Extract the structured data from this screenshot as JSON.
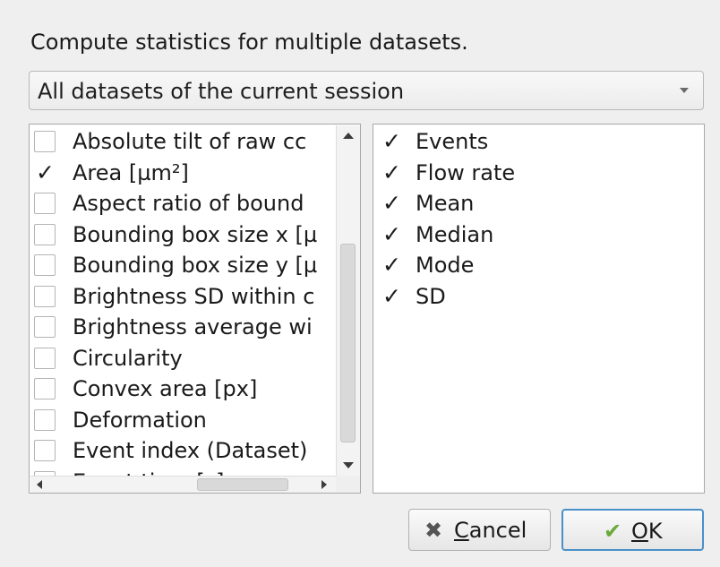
{
  "dialog": {
    "heading": "Compute statistics for multiple datasets.",
    "dataset_select": {
      "selected": "All datasets of the current session",
      "arrow_icon": "chevron-down-icon"
    }
  },
  "features": [
    {
      "label": "Absolute tilt of raw cc",
      "checked": false
    },
    {
      "label": "Area [µm²]",
      "checked": true
    },
    {
      "label": "Aspect ratio of bound",
      "checked": false
    },
    {
      "label": "Bounding box size x [µ",
      "checked": false
    },
    {
      "label": "Bounding box size y [µ",
      "checked": false
    },
    {
      "label": "Brightness SD within c",
      "checked": false
    },
    {
      "label": "Brightness average wi",
      "checked": false
    },
    {
      "label": "Circularity",
      "checked": false
    },
    {
      "label": "Convex area [px]",
      "checked": false
    },
    {
      "label": "Deformation",
      "checked": false
    },
    {
      "label": "Event index (Dataset)",
      "checked": false
    },
    {
      "label": "Event time [s]",
      "checked": false
    }
  ],
  "statistics": [
    {
      "label": "Events",
      "checked": true
    },
    {
      "label": "Flow rate",
      "checked": true
    },
    {
      "label": "Mean",
      "checked": true
    },
    {
      "label": "Median",
      "checked": true
    },
    {
      "label": "Mode",
      "checked": true
    },
    {
      "label": "SD",
      "checked": true
    }
  ],
  "buttons": {
    "cancel": {
      "mnemonic": "C",
      "rest": "ancel",
      "icon": "cancel-x-icon"
    },
    "ok": {
      "mnemonic": "O",
      "rest": "K",
      "icon": "checkmark-icon"
    }
  },
  "glyphs": {
    "check": "✓",
    "cancel": "✖",
    "ok": "✔"
  },
  "colors": {
    "ok_border": "#4a90c8",
    "ok_icon": "#6aa93a"
  }
}
